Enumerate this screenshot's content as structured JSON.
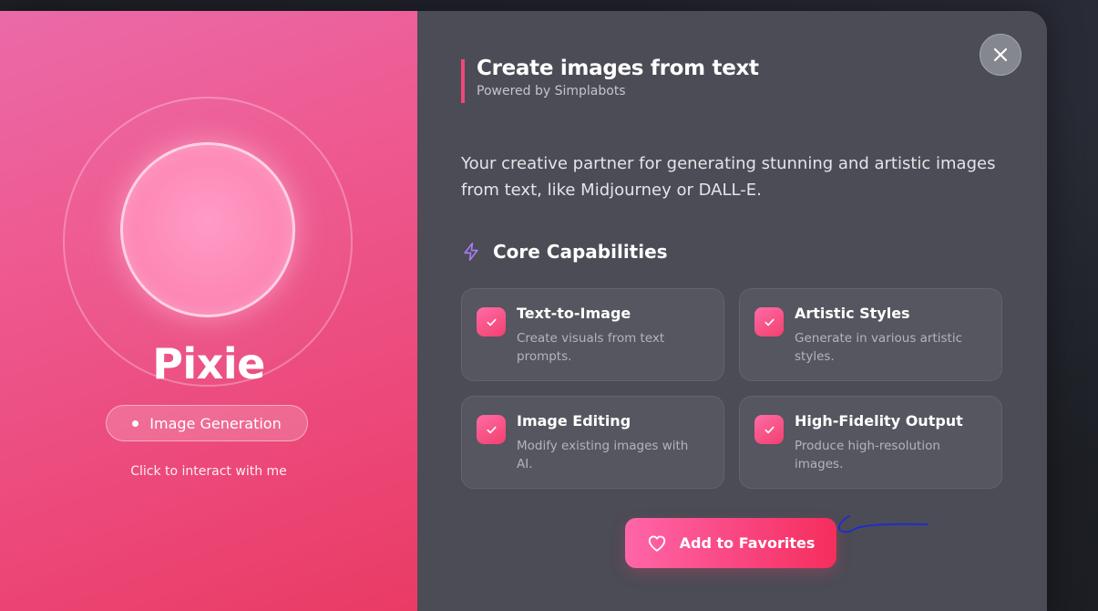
{
  "bot": {
    "name": "Pixie",
    "category": "Image Generation",
    "hint": "Click to interact with me"
  },
  "header": {
    "title": "Create images from text",
    "subtitle": "Powered by Simplabots"
  },
  "description": "Your creative partner for generating stunning and artistic images from text, like Midjourney or DALL-E.",
  "capabilities": {
    "heading": "Core Capabilities",
    "items": [
      {
        "title": "Text-to-Image",
        "desc": "Create visuals from text prompts."
      },
      {
        "title": "Artistic Styles",
        "desc": "Generate in various artistic styles."
      },
      {
        "title": "Image Editing",
        "desc": "Modify existing images with AI."
      },
      {
        "title": "High-Fidelity Output",
        "desc": "Produce high-resolution images."
      }
    ]
  },
  "actions": {
    "favorite_label": "Add to Favorites"
  },
  "icons": {
    "close": "close-icon",
    "capabilities": "lightning-bolt-icon",
    "check": "checkmark-icon",
    "favorite": "heart-icon"
  },
  "colors": {
    "accent": "#f0477b",
    "left_panel_start": "#ea6aa8",
    "left_panel_end": "#ea3a64",
    "panel_bg": "#4b4c55",
    "bolt": "#a77cf0",
    "annotation": "#1c2bd6"
  }
}
